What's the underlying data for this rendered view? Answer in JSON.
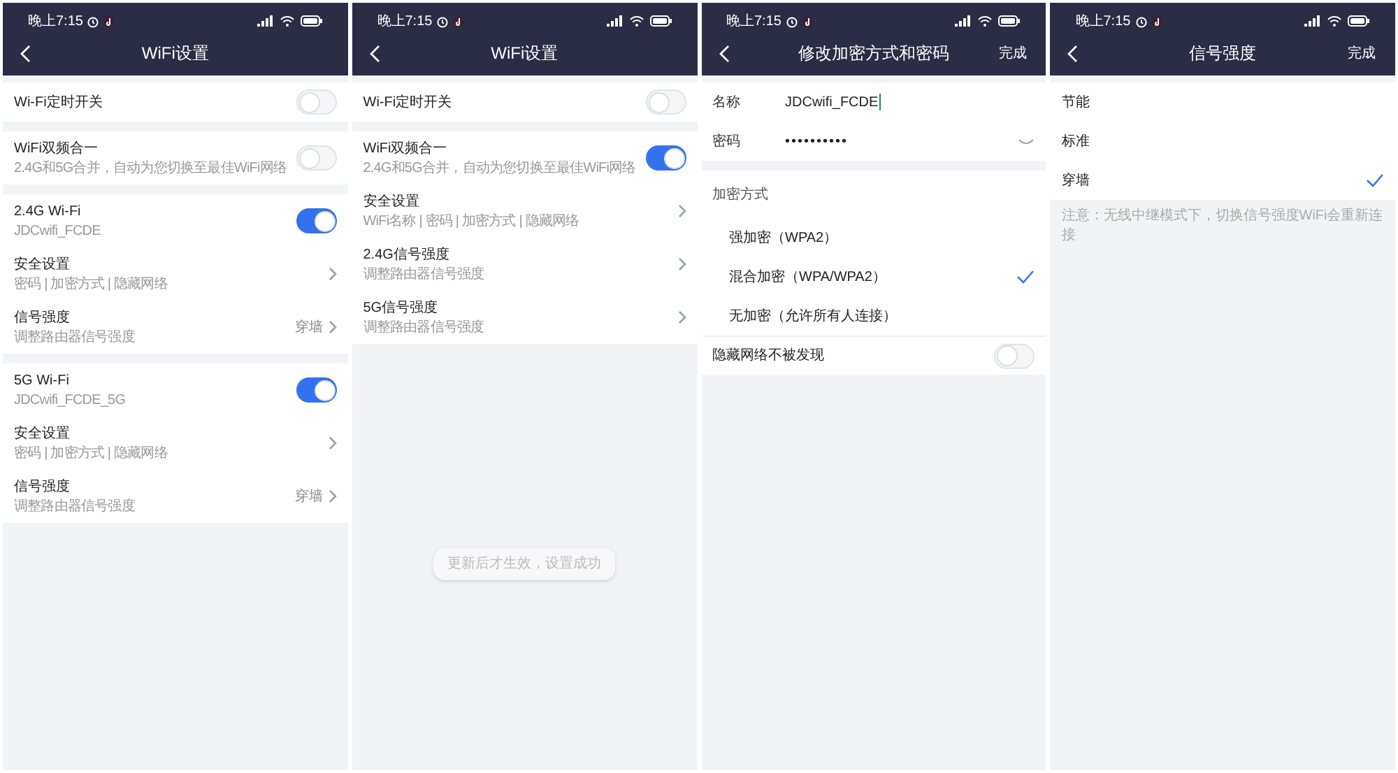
{
  "screens": [
    {
      "time": "晚上7:15",
      "title": "WiFi设置",
      "sections": [
        {
          "rows": [
            {
              "kind": "toggle",
              "label": "Wi-Fi定时开关",
              "on": false
            }
          ]
        },
        {
          "rows": [
            {
              "kind": "toggle",
              "label": "WiFi双频合一",
              "sub": "2.4G和5G合并，自动为您切换至最佳WiFi网络",
              "on": false
            }
          ]
        },
        {
          "rows": [
            {
              "kind": "toggle",
              "label": "2.4G Wi-Fi",
              "sub": "JDCwifi_FCDE",
              "on": true
            },
            {
              "kind": "link",
              "label": "安全设置",
              "sub": "密码 | 加密方式 | 隐藏网络"
            },
            {
              "kind": "link",
              "label": "信号强度",
              "sub": "调整路由器信号强度",
              "value": "穿墙"
            }
          ]
        },
        {
          "rows": [
            {
              "kind": "toggle",
              "label": "5G Wi-Fi",
              "sub": "JDCwifi_FCDE_5G",
              "on": true
            },
            {
              "kind": "link",
              "label": "安全设置",
              "sub": "密码 | 加密方式 | 隐藏网络"
            },
            {
              "kind": "link",
              "label": "信号强度",
              "sub": "调整路由器信号强度",
              "value": "穿墙"
            }
          ]
        }
      ]
    },
    {
      "time": "晚上7:15",
      "title": "WiFi设置",
      "toast": "更新后才生效，设置成功",
      "sections": [
        {
          "rows": [
            {
              "kind": "toggle",
              "label": "Wi-Fi定时开关",
              "on": false
            }
          ]
        },
        {
          "rows": [
            {
              "kind": "toggle",
              "label": "WiFi双频合一",
              "sub": "2.4G和5G合并，自动为您切换至最佳WiFi网络",
              "on": true
            },
            {
              "kind": "link",
              "label": "安全设置",
              "sub": "WiFi名称 | 密码 | 加密方式 | 隐藏网络"
            },
            {
              "kind": "link",
              "label": "2.4G信号强度",
              "sub": "调整路由器信号强度"
            },
            {
              "kind": "link",
              "label": "5G信号强度",
              "sub": "调整路由器信号强度"
            }
          ]
        }
      ]
    },
    {
      "time": "晚上7:15",
      "title": "修改加密方式和密码",
      "action": "完成",
      "sections": [
        {
          "rows": [
            {
              "kind": "field",
              "label": "名称",
              "value": "JDCwifi_FCDE"
            },
            {
              "kind": "password",
              "label": "密码",
              "value": "••••••••••"
            }
          ]
        },
        {
          "rows": [
            {
              "kind": "header",
              "label": "加密方式"
            },
            {
              "kind": "suboption",
              "label": "强加密（WPA2）",
              "selected": false
            },
            {
              "kind": "suboption",
              "label": "混合加密（WPA/WPA2）",
              "selected": true
            },
            {
              "kind": "suboption",
              "label": "无加密（允许所有人连接）",
              "selected": false
            },
            {
              "kind": "toggle",
              "label": "隐藏网络不被发现",
              "on": false
            }
          ]
        }
      ]
    },
    {
      "time": "晚上7:15",
      "title": "信号强度",
      "action": "完成",
      "note": "注意：无线中继模式下，切换信号强度WiFi会重新连接",
      "sections": [
        {
          "rows": [
            {
              "kind": "option",
              "label": "节能",
              "selected": false
            },
            {
              "kind": "option",
              "label": "标准",
              "selected": false
            },
            {
              "kind": "option",
              "label": "穿墙",
              "selected": true
            }
          ]
        }
      ]
    }
  ]
}
